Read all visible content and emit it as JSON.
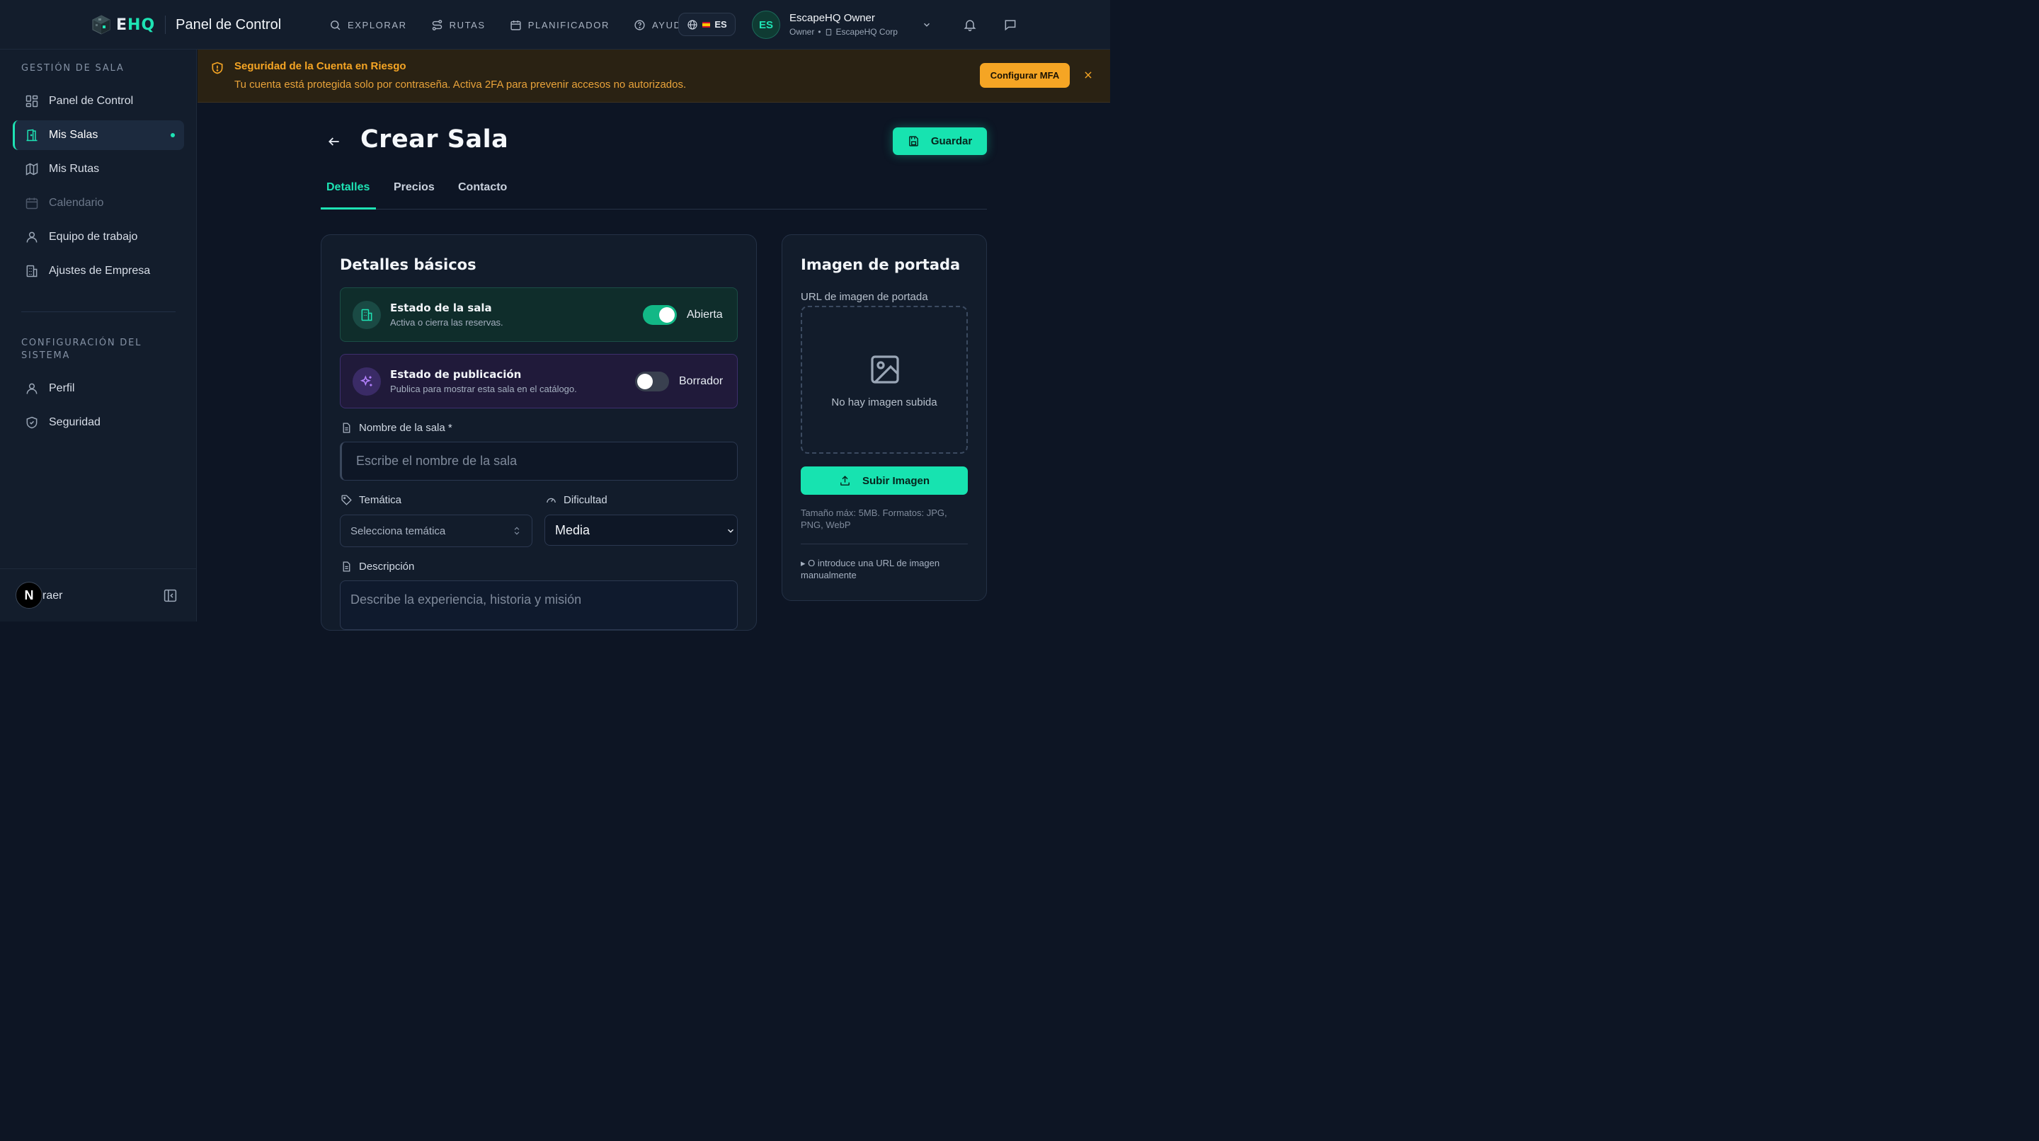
{
  "brand": {
    "name_prefix": "E",
    "name_suffix": "HQ",
    "title": "Panel de Control"
  },
  "nav": [
    {
      "label": "EXPLORAR",
      "icon": "search-icon"
    },
    {
      "label": "RUTAS",
      "icon": "route-icon"
    },
    {
      "label": "PLANIFICADOR",
      "icon": "calendar-icon"
    },
    {
      "label": "AYUDA",
      "icon": "help-circle-icon"
    }
  ],
  "language": {
    "code": "ES"
  },
  "user": {
    "initials": "ES",
    "name": "EscapeHQ Owner",
    "role": "Owner",
    "separator": "•",
    "company": "EscapeHQ Corp"
  },
  "sidebar": {
    "section1": "GESTIÓN DE SALA",
    "items1": [
      {
        "label": "Panel de Control",
        "icon": "dashboard-icon"
      },
      {
        "label": "Mis Salas",
        "icon": "door-icon",
        "active": true
      },
      {
        "label": "Mis Rutas",
        "icon": "map-icon"
      },
      {
        "label": "Calendario",
        "icon": "calendar-icon",
        "disabled": true
      },
      {
        "label": "Equipo de trabajo",
        "icon": "user-icon"
      },
      {
        "label": "Ajustes de Empresa",
        "icon": "building-icon"
      }
    ],
    "section2": "CONFIGURACIÓN DEL SISTEMA",
    "items2": [
      {
        "label": "Perfil",
        "icon": "user-icon"
      },
      {
        "label": "Seguridad",
        "icon": "shield-icon"
      }
    ],
    "collapse_label": "raer",
    "badge": "N"
  },
  "alert": {
    "title": "Seguridad de la Cuenta en Riesgo",
    "text": "Tu cuenta está protegida solo por contraseña. Activa 2FA para prevenir accesos no autorizados.",
    "button": "Configurar MFA"
  },
  "page": {
    "title": "Crear Sala",
    "save_label": "Guardar",
    "tabs": [
      {
        "label": "Detalles",
        "active": true
      },
      {
        "label": "Precios"
      },
      {
        "label": "Contacto"
      }
    ]
  },
  "details": {
    "title": "Detalles básicos",
    "room_status": {
      "title": "Estado de la sala",
      "subtitle": "Activa o cierra las reservas.",
      "value": "Abierta",
      "enabled": true
    },
    "publish_status": {
      "title": "Estado de publicación",
      "subtitle": "Publica para mostrar esta sala en el catálogo.",
      "value": "Borrador",
      "enabled": false
    },
    "name_label": "Nombre de la sala *",
    "name_placeholder": "Escribe el nombre de la sala",
    "theme_label": "Temática",
    "theme_placeholder": "Selecciona temática",
    "difficulty_label": "Dificultad",
    "difficulty_value": "Media",
    "description_label": "Descripción",
    "description_placeholder": "Describe la experiencia, historia y misión"
  },
  "cover": {
    "title": "Imagen de portada",
    "url_label": "URL de imagen de portada",
    "empty_text": "No hay imagen subida",
    "upload_label": "Subir Imagen",
    "hint": "Tamaño máx: 5MB. Formatos: JPG, PNG, WebP",
    "manual_label": "▸ O introduce una URL de imagen manualmente"
  },
  "colors": {
    "accent": "#1ee3b4",
    "warning": "#f5a524",
    "background": "#0d1524",
    "panel": "#131d2c"
  }
}
